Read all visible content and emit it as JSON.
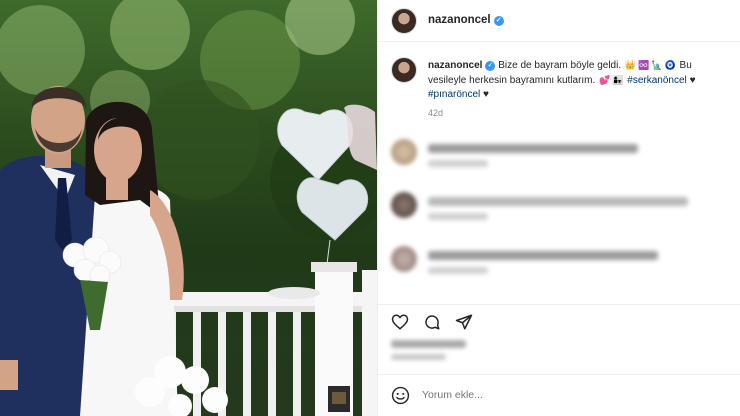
{
  "post": {
    "author": "nazanoncel",
    "verified_mark": "✓",
    "caption_text_1": "Bize de bayram böyle geldi.",
    "caption_text_2": "Bu vesileyle herkesin bayramını kutlarım.",
    "hashtag_1": "#serkanöncel",
    "hashtag_2": "#pınaröncel",
    "heart": "♥",
    "time_ago": "42d"
  },
  "comments": [
    {
      "id": 1,
      "blurred": true
    },
    {
      "id": 2,
      "blurred": true
    },
    {
      "id": 3,
      "blurred": true
    }
  ],
  "actions": {
    "like_icon": "heart-icon",
    "comment_icon": "comment-icon",
    "share_icon": "share-icon"
  },
  "comment_box": {
    "placeholder": "Yorum ekle..."
  },
  "colors": {
    "verified": "#3897f0",
    "hashtag": "#00376b",
    "muted": "#8e8e8e"
  }
}
